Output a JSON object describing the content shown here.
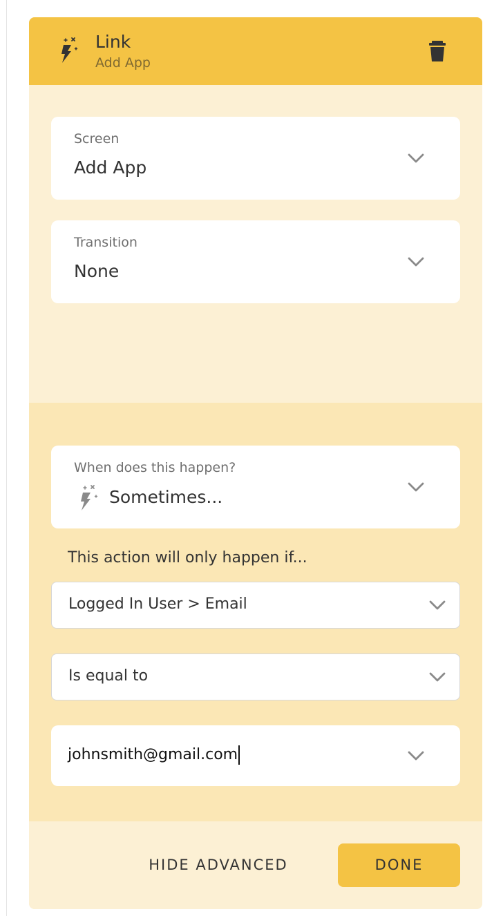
{
  "header": {
    "title": "Link",
    "subtitle": "Add App",
    "icon": "magic-action-icon",
    "delete_icon": "trash-icon"
  },
  "screen_field": {
    "label": "Screen",
    "value": "Add App"
  },
  "transition_field": {
    "label": "Transition",
    "value": "None"
  },
  "when_field": {
    "label": "When does this happen?",
    "value": "Sometimes...",
    "icon": "magic-action-icon"
  },
  "condition": {
    "intro": "This action will only happen if...",
    "property": "Logged In User > Email",
    "operator": "Is equal to",
    "value": "johnsmith@gmail.com"
  },
  "footer": {
    "hide_advanced_label": "HIDE ADVANCED",
    "done_label": "DONE"
  },
  "colors": {
    "accent": "#f4c344",
    "panel_light": "#fcf0d4",
    "panel_advanced": "#fbe7b5"
  }
}
